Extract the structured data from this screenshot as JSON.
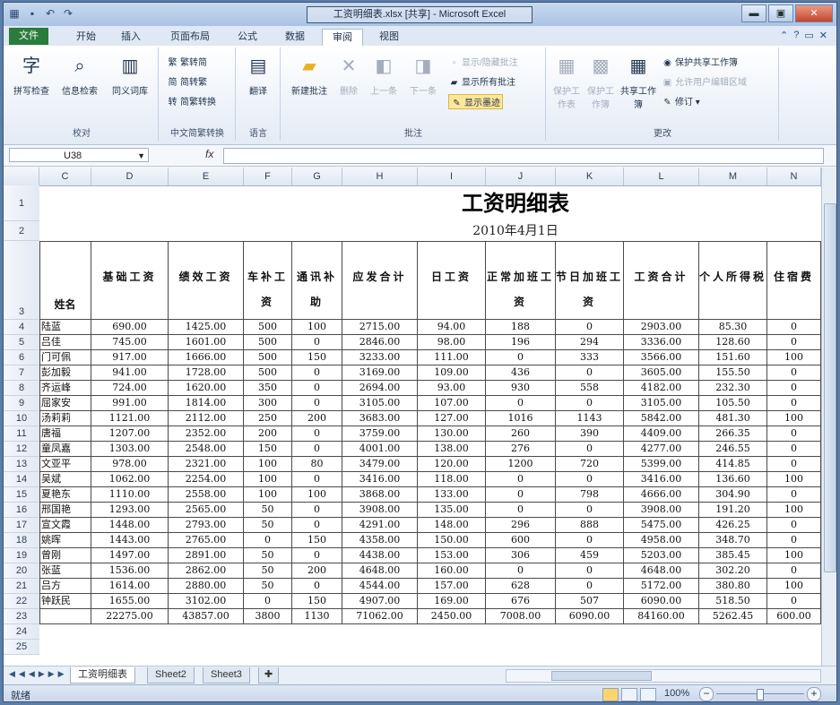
{
  "window": {
    "title": "工资明细表.xlsx [共享] - Microsoft Excel",
    "controls": {
      "minimize": "▬",
      "maximize": "▣",
      "close": "✕"
    }
  },
  "qat": [
    "save-icon",
    "undo-icon",
    "redo-icon"
  ],
  "tabs": [
    "文件",
    "开始",
    "插入",
    "页面布局",
    "公式",
    "数据",
    "审阅",
    "视图"
  ],
  "active_tab": "审阅",
  "ribbon": {
    "groups": {
      "proofing": {
        "label": "校对",
        "buttons": [
          "拼写检查",
          "信息检索",
          "同义词库"
        ]
      },
      "chinese": {
        "label": "中文简繁转换",
        "buttons": [
          "繁转简",
          "简转繁",
          "简繁转换"
        ]
      },
      "language": {
        "label": "语言",
        "buttons": [
          "翻译"
        ]
      },
      "comments": {
        "label": "批注",
        "big": [
          "新建批注",
          "删除",
          "上一条",
          "下一条"
        ],
        "small": [
          "显示/隐藏批注",
          "显示所有批注",
          "显示墨迹"
        ]
      },
      "changes": {
        "label": "更改",
        "big": [
          "保护工作表",
          "保护工作簿",
          "共享工作簿"
        ],
        "small": [
          "保护共享工作簿",
          "允许用户编辑区域",
          "修订"
        ]
      }
    }
  },
  "formula_bar": {
    "name_box": "U38",
    "fx": "fx",
    "formula": ""
  },
  "sheet": {
    "columns": [
      "C",
      "D",
      "E",
      "F",
      "G",
      "H",
      "I",
      "J",
      "K",
      "L",
      "M",
      "N"
    ],
    "title": "工资明细表",
    "date": "2010年4月1日",
    "headers": [
      "姓名",
      "基础工资",
      "绩效工资",
      "车补工资",
      "通讯补助",
      "应发合计",
      "日工资",
      "正常加班工资",
      "节日加班工资",
      "工资合计",
      "个人所得税",
      "住宿费"
    ],
    "rows": [
      [
        "陆蓝",
        "690.00",
        "1425.00",
        "500",
        "100",
        "2715.00",
        "94.00",
        "188",
        "0",
        "2903.00",
        "85.30",
        "0"
      ],
      [
        "吕佳",
        "745.00",
        "1601.00",
        "500",
        "0",
        "2846.00",
        "98.00",
        "196",
        "294",
        "3336.00",
        "128.60",
        "0"
      ],
      [
        "门可佩",
        "917.00",
        "1666.00",
        "500",
        "150",
        "3233.00",
        "111.00",
        "0",
        "333",
        "3566.00",
        "151.60",
        "100"
      ],
      [
        "彭加毅",
        "941.00",
        "1728.00",
        "500",
        "0",
        "3169.00",
        "109.00",
        "436",
        "0",
        "3605.00",
        "155.50",
        "0"
      ],
      [
        "齐运峰",
        "724.00",
        "1620.00",
        "350",
        "0",
        "2694.00",
        "93.00",
        "930",
        "558",
        "4182.00",
        "232.30",
        "0"
      ],
      [
        "屈家安",
        "991.00",
        "1814.00",
        "300",
        "0",
        "3105.00",
        "107.00",
        "0",
        "0",
        "3105.00",
        "105.50",
        "0"
      ],
      [
        "汤莉莉",
        "1121.00",
        "2112.00",
        "250",
        "200",
        "3683.00",
        "127.00",
        "1016",
        "1143",
        "5842.00",
        "481.30",
        "100"
      ],
      [
        "唐福",
        "1207.00",
        "2352.00",
        "200",
        "0",
        "3759.00",
        "130.00",
        "260",
        "390",
        "4409.00",
        "266.35",
        "0"
      ],
      [
        "童凤嘉",
        "1303.00",
        "2548.00",
        "150",
        "0",
        "4001.00",
        "138.00",
        "276",
        "0",
        "4277.00",
        "246.55",
        "0"
      ],
      [
        "文亚平",
        "978.00",
        "2321.00",
        "100",
        "80",
        "3479.00",
        "120.00",
        "1200",
        "720",
        "5399.00",
        "414.85",
        "0"
      ],
      [
        "吴斌",
        "1062.00",
        "2254.00",
        "100",
        "0",
        "3416.00",
        "118.00",
        "0",
        "0",
        "3416.00",
        "136.60",
        "100"
      ],
      [
        "夏艳东",
        "1110.00",
        "2558.00",
        "100",
        "100",
        "3868.00",
        "133.00",
        "0",
        "798",
        "4666.00",
        "304.90",
        "0"
      ],
      [
        "邢国艳",
        "1293.00",
        "2565.00",
        "50",
        "0",
        "3908.00",
        "135.00",
        "0",
        "0",
        "3908.00",
        "191.20",
        "100"
      ],
      [
        "宣文霞",
        "1448.00",
        "2793.00",
        "50",
        "0",
        "4291.00",
        "148.00",
        "296",
        "888",
        "5475.00",
        "426.25",
        "0"
      ],
      [
        "姚晖",
        "1443.00",
        "2765.00",
        "0",
        "150",
        "4358.00",
        "150.00",
        "600",
        "0",
        "4958.00",
        "348.70",
        "0"
      ],
      [
        "曾刚",
        "1497.00",
        "2891.00",
        "50",
        "0",
        "4438.00",
        "153.00",
        "306",
        "459",
        "5203.00",
        "385.45",
        "100"
      ],
      [
        "张蓝",
        "1536.00",
        "2862.00",
        "50",
        "200",
        "4648.00",
        "160.00",
        "0",
        "0",
        "4648.00",
        "302.20",
        "0"
      ],
      [
        "吕方",
        "1614.00",
        "2880.00",
        "50",
        "0",
        "4544.00",
        "157.00",
        "628",
        "0",
        "5172.00",
        "380.80",
        "100"
      ],
      [
        "钟跃民",
        "1655.00",
        "3102.00",
        "0",
        "150",
        "4907.00",
        "169.00",
        "676",
        "507",
        "6090.00",
        "518.50",
        "0"
      ]
    ],
    "totals": [
      "",
      "22275.00",
      "43857.00",
      "3800",
      "1130",
      "71062.00",
      "2450.00",
      "7008.00",
      "6090.00",
      "84160.00",
      "5262.45",
      "600.00"
    ],
    "row_numbers": [
      "1",
      "2",
      "3",
      "4",
      "5",
      "6",
      "7",
      "8",
      "9",
      "10",
      "11",
      "12",
      "13",
      "14",
      "15",
      "16",
      "17",
      "18",
      "19",
      "20",
      "21",
      "22",
      "23",
      "24",
      "25"
    ]
  },
  "sheet_tabs": [
    "工资明细表",
    "Sheet2",
    "Sheet3"
  ],
  "active_sheet": "工资明细表",
  "status": {
    "ready": "就绪",
    "zoom": "100%"
  }
}
